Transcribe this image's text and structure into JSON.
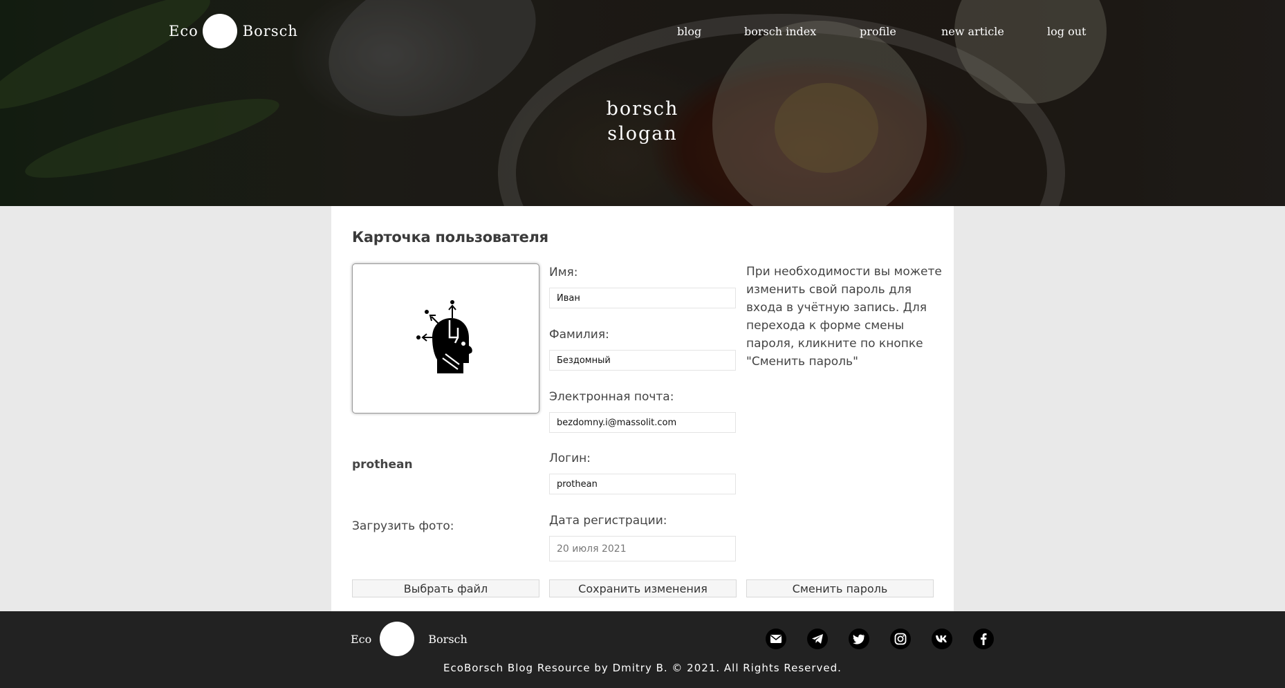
{
  "header": {
    "logo_left": "Eco",
    "logo_right": "Borsch",
    "nav": [
      {
        "label": "blog"
      },
      {
        "label": "borsch index"
      },
      {
        "label": "profile"
      },
      {
        "label": "new article"
      },
      {
        "label": "log out"
      }
    ],
    "slogan_line1": "borsch",
    "slogan_line2": "slogan"
  },
  "card": {
    "title": "Карточка пользователя",
    "username": "prothean",
    "upload_label": "Загрузить фото:",
    "fields": {
      "first_name": {
        "label": "Имя:",
        "value": "Иван"
      },
      "last_name": {
        "label": "Фамилия:",
        "value": "Бездомный"
      },
      "email": {
        "label": "Электронная почта:",
        "value": "bezdomny.i@massolit.com"
      },
      "login": {
        "label": "Логин:",
        "value": "prothean"
      },
      "registered": {
        "label": "Дата регистрации:",
        "value": "20 июля 2021"
      }
    },
    "info_text": "При необходимости вы можете изменить свой пароль для входа в учётную запись. Для перехода к форме смены пароля, кликните по кнопке \"Сменить пароль\"",
    "buttons": {
      "choose_file": "Выбрать файл",
      "save": "Сохранить изменения",
      "change_password": "Сменить пароль"
    }
  },
  "footer": {
    "logo_left": "Eco",
    "logo_right": "Borsch",
    "social": [
      "mail-icon",
      "telegram-icon",
      "twitter-icon",
      "instagram-icon",
      "vk-icon",
      "facebook-icon"
    ],
    "copyright": "EcoBorsch Blog Resource by Dmitry B. © 2021. All Rights Reserved."
  },
  "colors": {
    "page_bg": "#e9e9e9",
    "card_bg": "#ffffff",
    "footer_bg": "#222222",
    "text": "#444444"
  }
}
